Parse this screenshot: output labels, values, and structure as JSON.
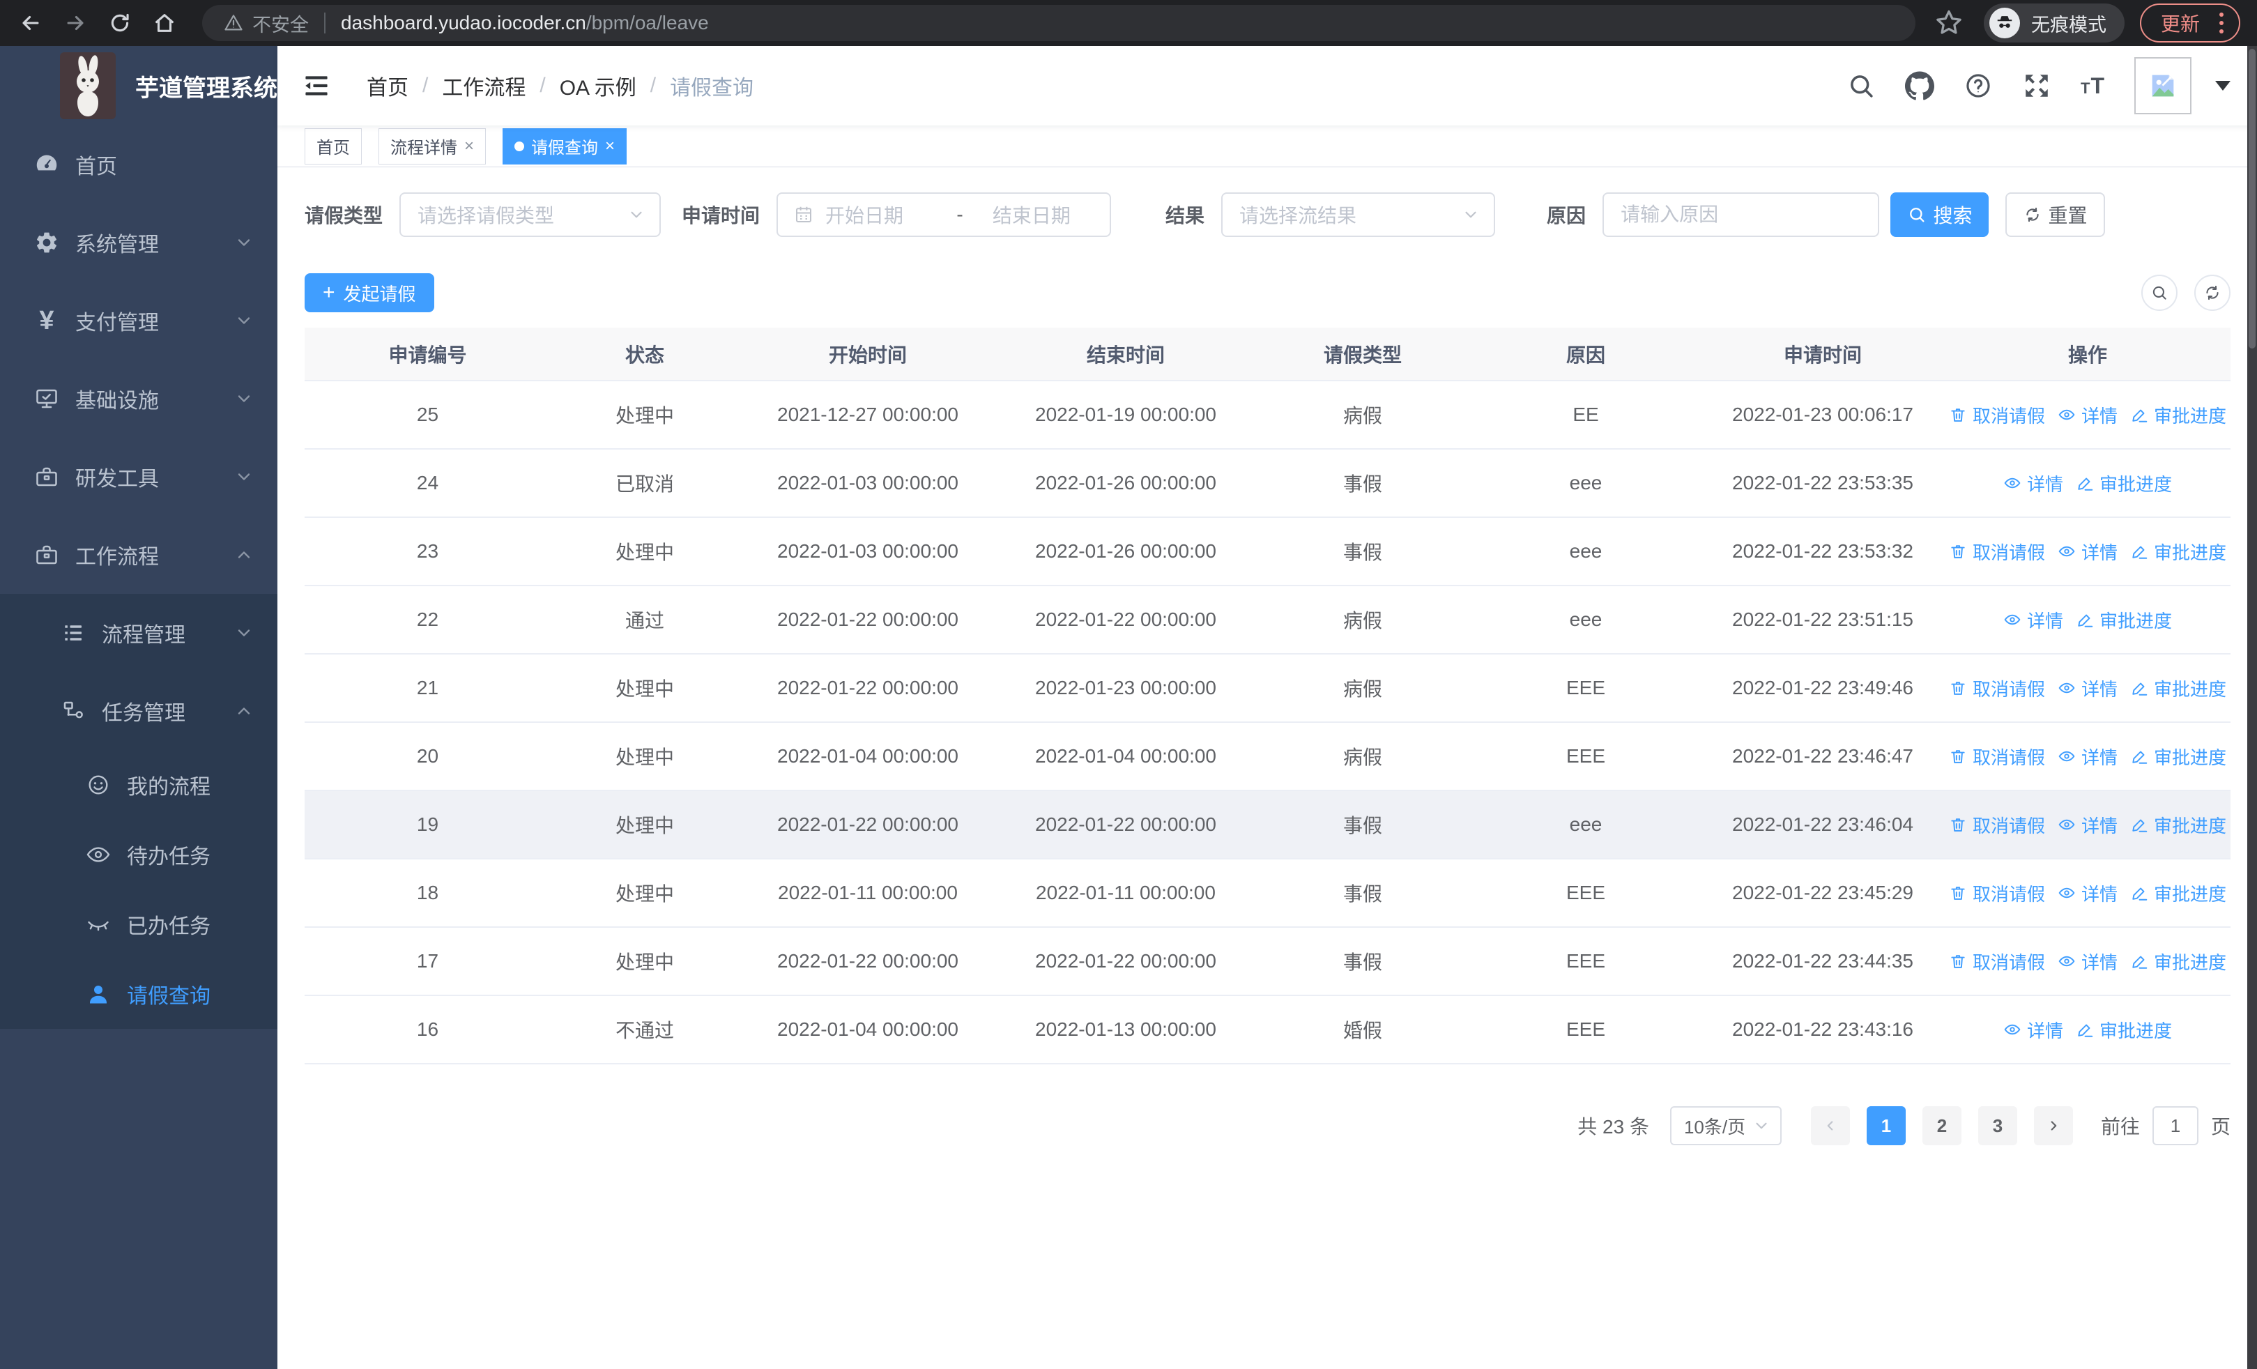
{
  "browser": {
    "security_label": "不安全",
    "url_host": "dashboard.yudao.iocoder.cn",
    "url_path": "/bpm/oa/leave",
    "incognito_label": "无痕模式",
    "update_label": "更新"
  },
  "app": {
    "title": "芋道管理系统"
  },
  "breadcrumb": {
    "items": [
      "首页",
      "工作流程",
      "OA 示例",
      "请假查询"
    ]
  },
  "tabs": [
    {
      "name": "home",
      "label": "首页",
      "closable": false,
      "active": false
    },
    {
      "name": "process-detail",
      "label": "流程详情",
      "closable": true,
      "active": false
    },
    {
      "name": "leave-query",
      "label": "请假查询",
      "closable": true,
      "active": true
    }
  ],
  "sidebar": {
    "items": [
      {
        "name": "home",
        "label": "首页",
        "icon": "dashboard-icon",
        "level": 0,
        "panel": false,
        "active": false,
        "chevron": null
      },
      {
        "name": "system-management",
        "label": "系统管理",
        "icon": "gear-icon",
        "level": 0,
        "panel": false,
        "active": false,
        "chevron": "down"
      },
      {
        "name": "payment-management",
        "label": "支付管理",
        "icon": "yen-icon",
        "level": 0,
        "panel": false,
        "active": false,
        "chevron": "down"
      },
      {
        "name": "infrastructure",
        "label": "基础设施",
        "icon": "monitor-icon",
        "level": 0,
        "panel": false,
        "active": false,
        "chevron": "down"
      },
      {
        "name": "dev-tools",
        "label": "研发工具",
        "icon": "toolbox-icon",
        "level": 0,
        "panel": false,
        "active": false,
        "chevron": "down"
      },
      {
        "name": "workflow",
        "label": "工作流程",
        "icon": "briefcase-icon",
        "level": 0,
        "panel": false,
        "active": false,
        "chevron": "up"
      },
      {
        "name": "process-management",
        "label": "流程管理",
        "icon": "list-icon",
        "level": 1,
        "panel": true,
        "active": false,
        "chevron": "down"
      },
      {
        "name": "task-management",
        "label": "任务管理",
        "icon": "flow-icon",
        "level": 1,
        "panel": true,
        "active": false,
        "chevron": "up"
      },
      {
        "name": "my-processes",
        "label": "我的流程",
        "icon": "robot-icon",
        "level": 2,
        "panel": true,
        "active": false,
        "chevron": null
      },
      {
        "name": "todo-tasks",
        "label": "待办任务",
        "icon": "eye-icon",
        "level": 2,
        "panel": true,
        "active": false,
        "chevron": null
      },
      {
        "name": "done-tasks",
        "label": "已办任务",
        "icon": "eye-closed-icon",
        "level": 2,
        "panel": true,
        "active": false,
        "chevron": null
      },
      {
        "name": "leave-query",
        "label": "请假查询",
        "icon": "user-icon",
        "level": 2,
        "panel": true,
        "active": true,
        "chevron": null
      }
    ]
  },
  "filters": {
    "type_label": "请假类型",
    "type_placeholder": "请选择请假类型",
    "time_label": "申请时间",
    "date_start_placeholder": "开始日期",
    "date_separator": "-",
    "date_end_placeholder": "结束日期",
    "result_label": "结果",
    "result_placeholder": "请选择流结果",
    "reason_label": "原因",
    "reason_placeholder": "请输入原因",
    "search_label": "搜索",
    "reset_label": "重置"
  },
  "toolbar": {
    "create_label": "发起请假",
    "plus_sign": "+"
  },
  "table": {
    "headers": [
      "申请编号",
      "状态",
      "开始时间",
      "结束时间",
      "请假类型",
      "原因",
      "申请时间",
      "操作"
    ],
    "action_defs": {
      "cancel": {
        "name": "cancel-leave-link",
        "label": "取消请假",
        "icon": "trash-icon"
      },
      "detail": {
        "name": "detail-link",
        "label": "详情",
        "icon": "eye-view-icon"
      },
      "progress": {
        "name": "progress-link",
        "label": "审批进度",
        "icon": "pen-icon"
      }
    },
    "rows": [
      {
        "id": "25",
        "status": "处理中",
        "start": "2021-12-27 00:00:00",
        "end": "2022-01-19 00:00:00",
        "type": "病假",
        "reason": "EE",
        "applyTime": "2022-01-23 00:06:17",
        "actions": [
          "cancel",
          "detail",
          "progress"
        ],
        "highlight": false
      },
      {
        "id": "24",
        "status": "已取消",
        "start": "2022-01-03 00:00:00",
        "end": "2022-01-26 00:00:00",
        "type": "事假",
        "reason": "eee",
        "applyTime": "2022-01-22 23:53:35",
        "actions": [
          "detail",
          "progress"
        ],
        "highlight": false
      },
      {
        "id": "23",
        "status": "处理中",
        "start": "2022-01-03 00:00:00",
        "end": "2022-01-26 00:00:00",
        "type": "事假",
        "reason": "eee",
        "applyTime": "2022-01-22 23:53:32",
        "actions": [
          "cancel",
          "detail",
          "progress"
        ],
        "highlight": false
      },
      {
        "id": "22",
        "status": "通过",
        "start": "2022-01-22 00:00:00",
        "end": "2022-01-22 00:00:00",
        "type": "病假",
        "reason": "eee",
        "applyTime": "2022-01-22 23:51:15",
        "actions": [
          "detail",
          "progress"
        ],
        "highlight": false
      },
      {
        "id": "21",
        "status": "处理中",
        "start": "2022-01-22 00:00:00",
        "end": "2022-01-23 00:00:00",
        "type": "病假",
        "reason": "EEE",
        "applyTime": "2022-01-22 23:49:46",
        "actions": [
          "cancel",
          "detail",
          "progress"
        ],
        "highlight": false
      },
      {
        "id": "20",
        "status": "处理中",
        "start": "2022-01-04 00:00:00",
        "end": "2022-01-04 00:00:00",
        "type": "病假",
        "reason": "EEE",
        "applyTime": "2022-01-22 23:46:47",
        "actions": [
          "cancel",
          "detail",
          "progress"
        ],
        "highlight": false
      },
      {
        "id": "19",
        "status": "处理中",
        "start": "2022-01-22 00:00:00",
        "end": "2022-01-22 00:00:00",
        "type": "事假",
        "reason": "eee",
        "applyTime": "2022-01-22 23:46:04",
        "actions": [
          "cancel",
          "detail",
          "progress"
        ],
        "highlight": true
      },
      {
        "id": "18",
        "status": "处理中",
        "start": "2022-01-11 00:00:00",
        "end": "2022-01-11 00:00:00",
        "type": "事假",
        "reason": "EEE",
        "applyTime": "2022-01-22 23:45:29",
        "actions": [
          "cancel",
          "detail",
          "progress"
        ],
        "highlight": false
      },
      {
        "id": "17",
        "status": "处理中",
        "start": "2022-01-22 00:00:00",
        "end": "2022-01-22 00:00:00",
        "type": "事假",
        "reason": "EEE",
        "applyTime": "2022-01-22 23:44:35",
        "actions": [
          "cancel",
          "detail",
          "progress"
        ],
        "highlight": false
      },
      {
        "id": "16",
        "status": "不通过",
        "start": "2022-01-04 00:00:00",
        "end": "2022-01-13 00:00:00",
        "type": "婚假",
        "reason": "EEE",
        "applyTime": "2022-01-22 23:43:16",
        "actions": [
          "detail",
          "progress"
        ],
        "highlight": false
      }
    ]
  },
  "pagination": {
    "total_label": "共 23 条",
    "page_size_label": "10条/页",
    "pages": [
      {
        "label": "1",
        "active": true
      },
      {
        "label": "2",
        "active": false
      },
      {
        "label": "3",
        "active": false
      }
    ],
    "goto_label": "前往",
    "goto_value": "1",
    "goto_suffix": "页"
  },
  "colors": {
    "primary": "#409eff",
    "sidebar_bg": "#35435c",
    "sidebar_panel_bg": "#2b3a50",
    "update_accent": "#f08d88",
    "table_header_bg": "#f8f8f9"
  }
}
